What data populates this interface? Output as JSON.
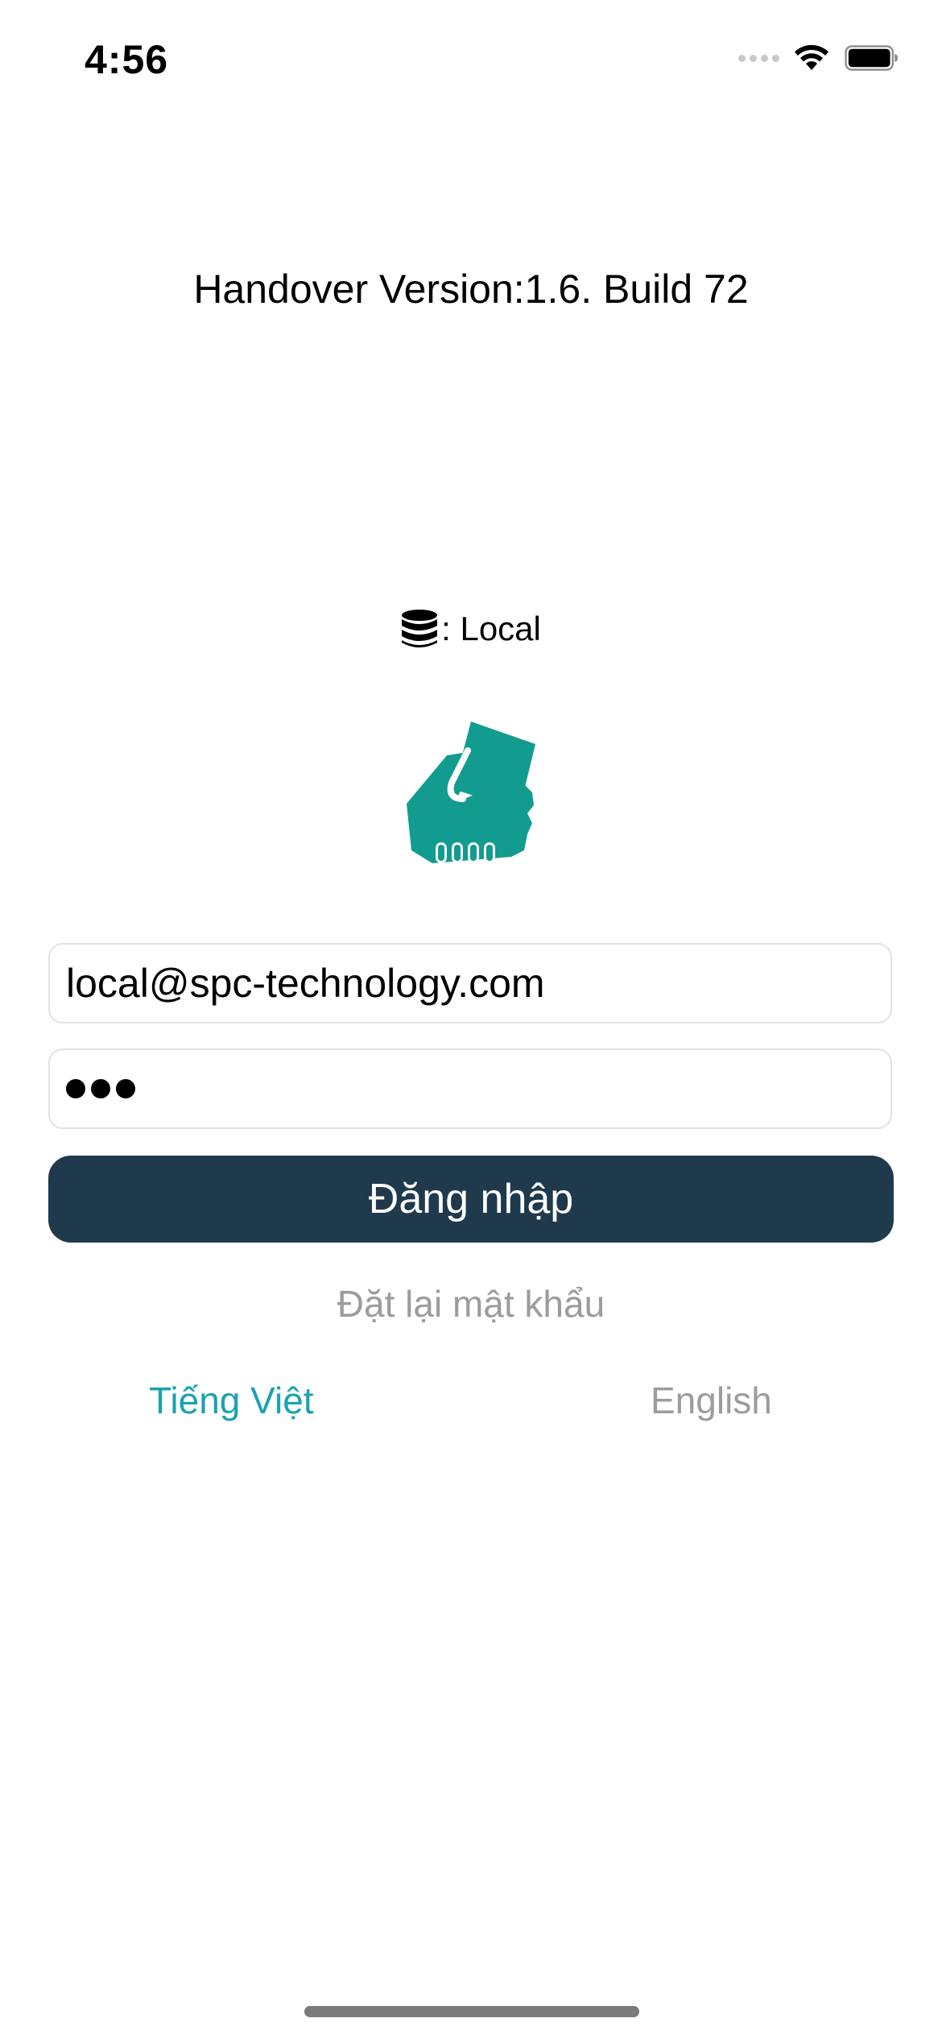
{
  "status_bar": {
    "time": "4:56"
  },
  "app": {
    "version_label": "Handover Version:1.6. Build 72",
    "server_label": ": Local",
    "brand_color": "#129c8f"
  },
  "login_form": {
    "email_value": "local@spc-technology.com",
    "password_mask_count": 3,
    "login_button_label": "Đăng nhập",
    "reset_password_label": "Đặt lại mật khẩu",
    "button_color": "#1f3a4c"
  },
  "language": {
    "options": [
      "Tiếng Việt",
      "English"
    ],
    "selected": "Tiếng Việt",
    "selected_color": "#19a2b2",
    "unselected_color": "#9b9ba1"
  },
  "icons": {
    "database": "database-icon",
    "logo": "hand-card-logo-icon",
    "wifi": "wifi-icon",
    "battery": "battery-icon",
    "signal": "cellular-signal-icon"
  }
}
